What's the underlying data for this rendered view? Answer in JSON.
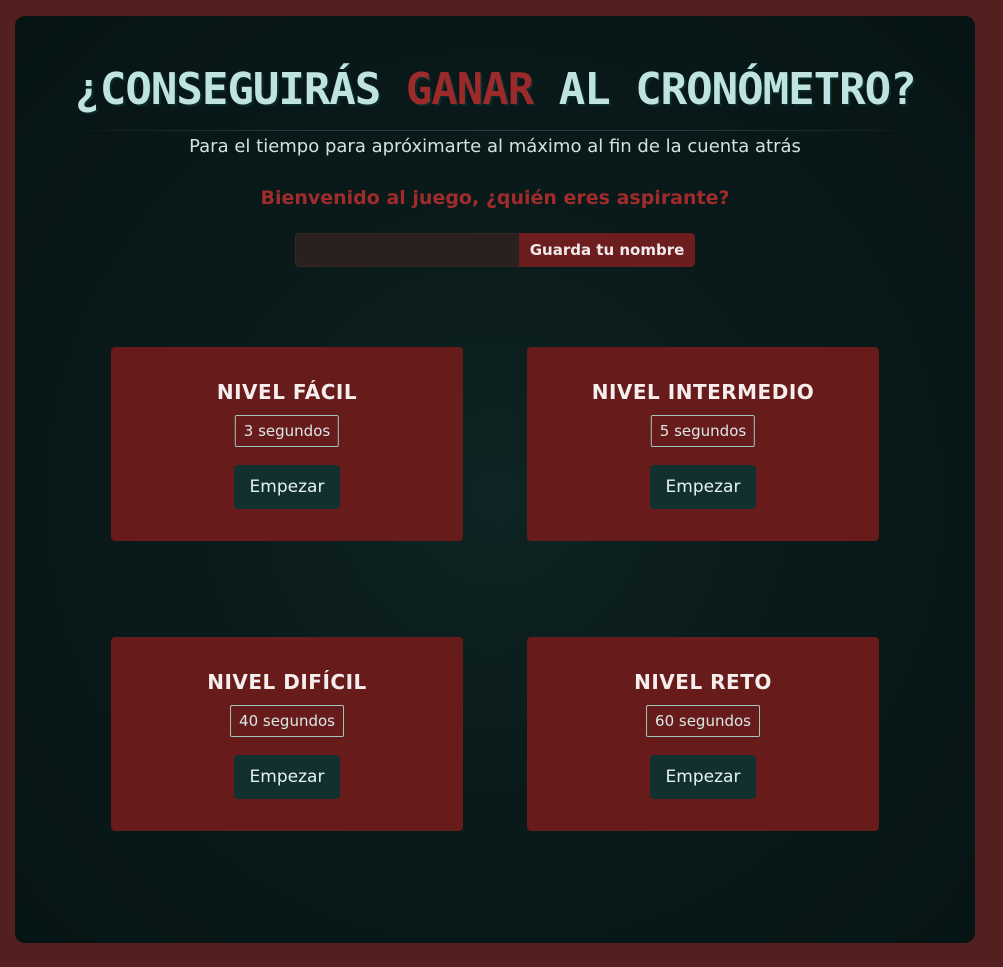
{
  "header": {
    "title_before": "¿CONSEGUIRÁS ",
    "title_accent": "GANAR",
    "title_after": " AL CRONÓMETRO?",
    "subtitle": "Para el tiempo para apróximarte al máximo al fin de la cuenta atrás"
  },
  "welcome": {
    "message": "Bienvenido al juego, ¿quién eres aspirante?",
    "input_value": "",
    "button_label": "Guarda tu nombre"
  },
  "levels": [
    {
      "title": "NIVEL FÁCIL",
      "time": "3 segundos",
      "button_label": "Empezar"
    },
    {
      "title": "NIVEL INTERMEDIO",
      "time": "5 segundos",
      "button_label": "Empezar"
    },
    {
      "title": "NIVEL DIFÍCIL",
      "time": "40 segundos",
      "button_label": "Empezar"
    },
    {
      "title": "NIVEL RETO",
      "time": "60 segundos",
      "button_label": "Empezar"
    }
  ],
  "colors": {
    "page_background": "#541f1f",
    "panel_background": "#0a1a1a",
    "accent_red": "#9c2a2a",
    "card_background": "#671b1b",
    "button_dark_teal": "#11302f",
    "text_light_teal": "#bfe3e0"
  }
}
